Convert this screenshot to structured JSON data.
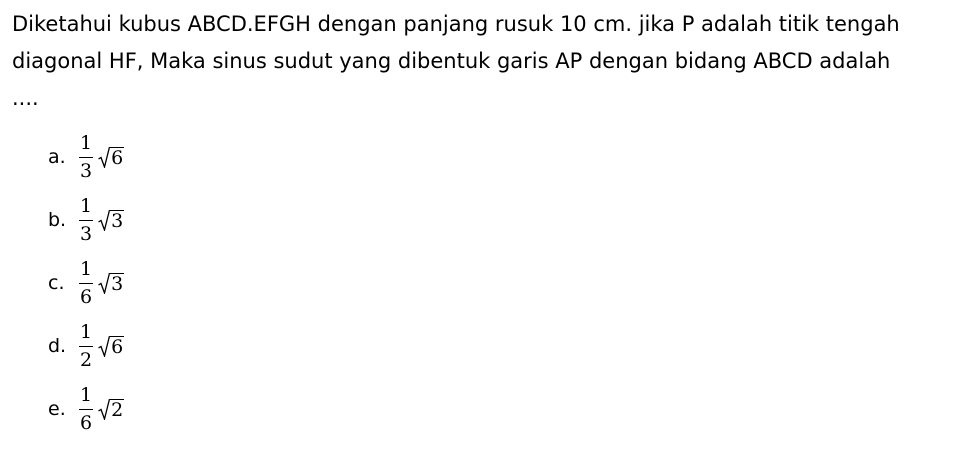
{
  "question": {
    "line1": "Diketahui kubus ABCD.EFGH dengan panjang rusuk 10 cm. jika P adalah titik tengah",
    "line2": "diagonal HF, Maka sinus sudut yang dibentuk garis AP dengan bidang ABCD adalah",
    "line3": "...."
  },
  "options": [
    {
      "letter": "a.",
      "numerator": "1",
      "denominator": "3",
      "radicand": "6"
    },
    {
      "letter": "b.",
      "numerator": "1",
      "denominator": "3",
      "radicand": "3"
    },
    {
      "letter": "c.",
      "numerator": "1",
      "denominator": "6",
      "radicand": "3"
    },
    {
      "letter": "d.",
      "numerator": "1",
      "denominator": "2",
      "radicand": "6"
    },
    {
      "letter": "e.",
      "numerator": "1",
      "denominator": "6",
      "radicand": "2"
    }
  ]
}
